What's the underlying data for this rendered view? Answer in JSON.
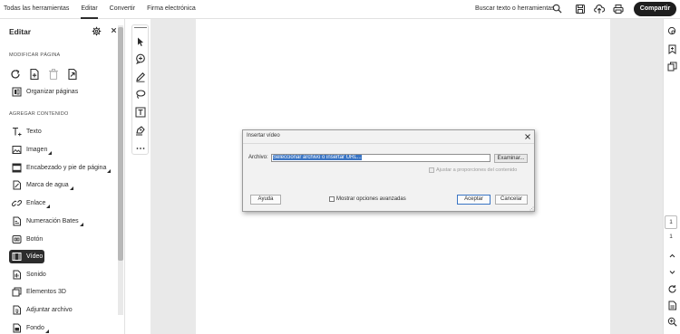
{
  "topbar": {
    "tabs": [
      "Todas las herramientas",
      "Editar",
      "Convertir",
      "Firma electrónica"
    ],
    "active_tab": "Editar",
    "search_label": "Buscar texto o herramientas",
    "share_label": "Compartir",
    "icons": [
      "search-icon",
      "save-icon",
      "cloud-upload-icon",
      "print-icon"
    ]
  },
  "left_panel": {
    "title": "Editar",
    "section_modify": "MODIFICAR PÁGINA",
    "organize_pages": "Organizar páginas",
    "section_add": "AGREGAR CONTENIDO",
    "items": [
      {
        "label": "Texto",
        "icon": "text-icon"
      },
      {
        "label": "Imagen",
        "icon": "image-icon"
      },
      {
        "label": "Encabezado y pie de página",
        "icon": "header-footer-icon"
      },
      {
        "label": "Marca de agua",
        "icon": "watermark-icon"
      },
      {
        "label": "Enlace",
        "icon": "link-icon"
      },
      {
        "label": "Numeración Bates",
        "icon": "bates-icon"
      },
      {
        "label": "Botón",
        "icon": "button-icon"
      },
      {
        "label": "Vídeo",
        "icon": "video-icon"
      },
      {
        "label": "Sonido",
        "icon": "sound-icon"
      },
      {
        "label": "Elementos 3D",
        "icon": "3d-icon"
      },
      {
        "label": "Adjuntar archivo",
        "icon": "attach-icon"
      },
      {
        "label": "Fondo",
        "icon": "background-icon"
      }
    ],
    "selected_item": "Vídeo"
  },
  "page_nav": {
    "current_page": "1",
    "total_pages": "1"
  },
  "dialog": {
    "title": "Insertar vídeo",
    "file_label": "Archivo:",
    "file_value": "Seleccionar archivo o insertar URL...",
    "browse_label": "Examinar...",
    "fit_proportions_label": "Ajustar a proporciones del contenido",
    "help_label": "Ayuda",
    "advanced_label": "Mostrar opciones avanzadas",
    "accept_label": "Aceptar",
    "cancel_label": "Cancelar"
  }
}
